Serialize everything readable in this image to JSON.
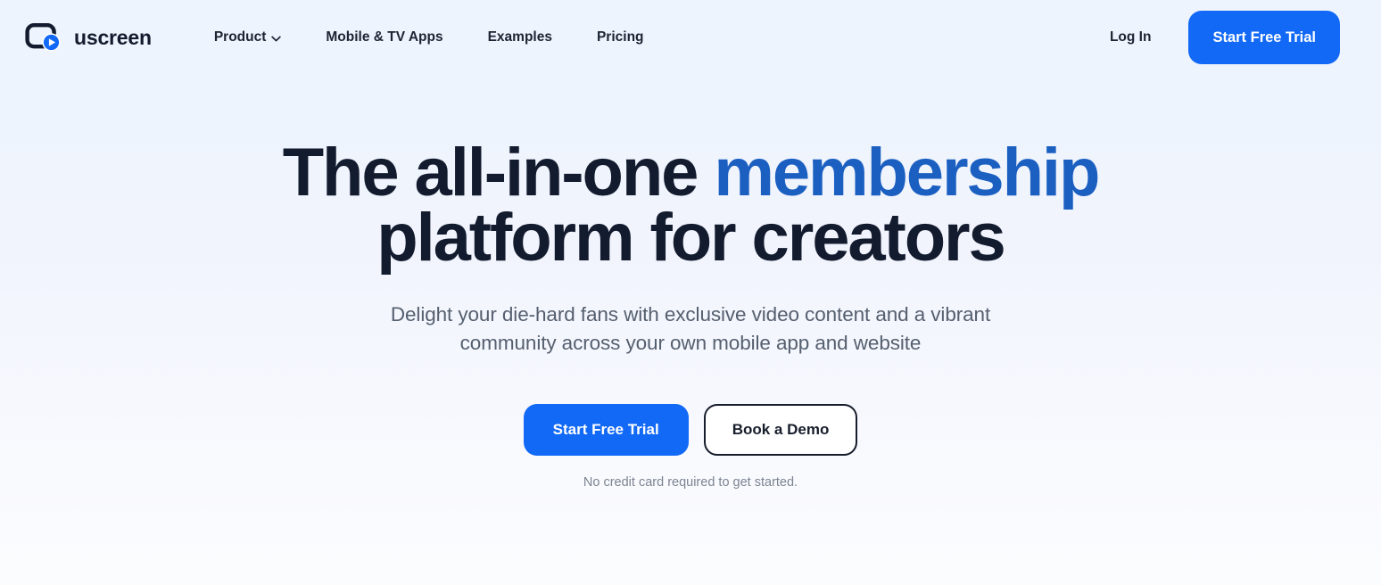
{
  "header": {
    "brand": {
      "name": "uscreen",
      "logo_icon": "uscreen-play-logo-icon",
      "logo_outline_color": "#131b2e",
      "logo_circle_color": "#1269f6"
    },
    "nav": [
      {
        "label": "Product",
        "has_dropdown": true,
        "icon": "chevron-down-icon"
      },
      {
        "label": "Mobile & TV Apps",
        "has_dropdown": false
      },
      {
        "label": "Examples",
        "has_dropdown": false
      },
      {
        "label": "Pricing",
        "has_dropdown": false
      }
    ],
    "login_label": "Log In",
    "cta_label": "Start Free Trial"
  },
  "hero": {
    "headline": {
      "line1": "The all-in-one",
      "accent_word": "membership",
      "line2_rest": " platform for",
      "line3": "creators"
    },
    "subheadline": "Delight your die-hard fans with exclusive video content and a vibrant community across your own mobile app and website",
    "primary_cta": "Start Free Trial",
    "secondary_cta": "Book a Demo",
    "fineprint": "No credit card required to get started."
  },
  "colors": {
    "accent_blue": "#1269f6",
    "headline_accent_blue": "#1b5fc1",
    "ink": "#131b2e",
    "muted_text": "#555f6e",
    "fineprint_text": "#7b8492",
    "bg_top": "#edf4fd",
    "bg_bottom": "#fbfcfe"
  }
}
